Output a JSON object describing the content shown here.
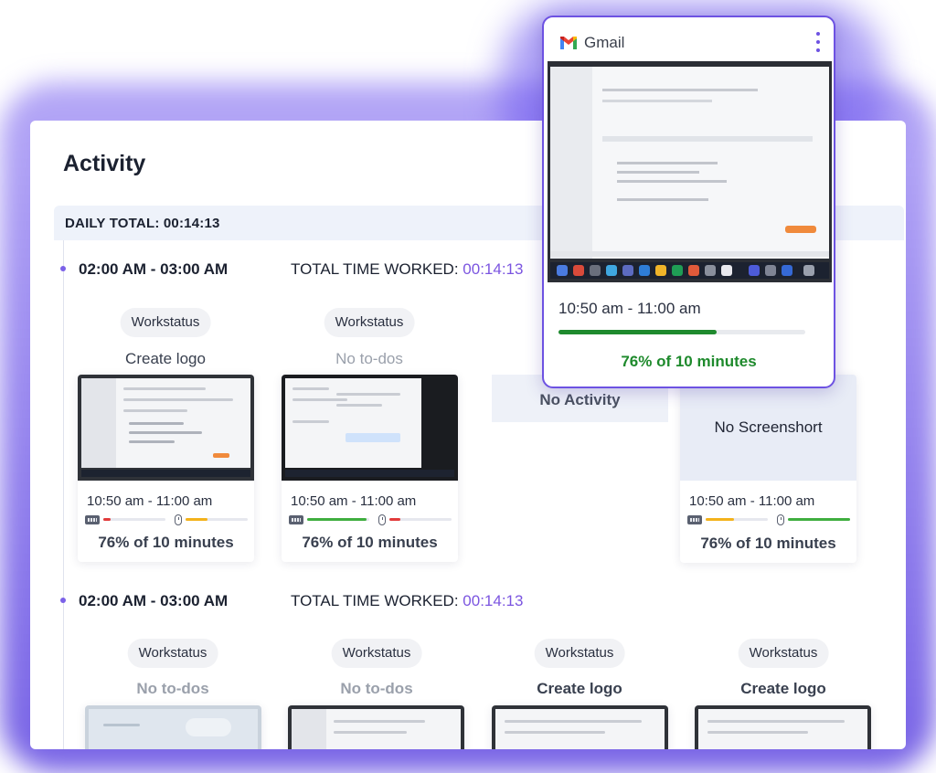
{
  "page": {
    "title": "Activity"
  },
  "daily_total": {
    "text": "DAILY TOTAL: 00:14:13"
  },
  "colors": {
    "accent": "#7b55e0",
    "green": "#3fae3f",
    "red": "#e23b3b",
    "yellow": "#f3b21b",
    "popup_green": "#1e8a2c"
  },
  "sections": [
    {
      "range": "02:00 AM - 03:00 AM",
      "total_label": "TOTAL TIME WORKED: ",
      "total_value": "00:14:13",
      "slots": [
        {
          "chip": "Workstatus",
          "todo": "Create logo",
          "time": "10:50 am - 11:00 am",
          "pct": "76% of 10 minutes",
          "keyboard_level": 0.12,
          "keyboard_color": "red",
          "mouse_level": 0.35,
          "mouse_color": "yellow"
        },
        {
          "chip": "Workstatus",
          "todo": "No to-dos",
          "time": "10:50 am - 11:00 am",
          "pct": "76% of 10 minutes",
          "keyboard_level": 0.95,
          "keyboard_color": "green",
          "mouse_level": 0.18,
          "mouse_color": "red"
        },
        {
          "label": "No Activity"
        },
        {
          "screenshot_placeholder": "No Screenshort",
          "time": "10:50 am - 11:00 am",
          "pct": "76% of 10 minutes",
          "keyboard_level": 0.45,
          "keyboard_color": "yellow",
          "mouse_level": 1.0,
          "mouse_color": "green"
        }
      ]
    },
    {
      "range": "02:00 AM - 03:00 AM",
      "total_label": "TOTAL TIME WORKED: ",
      "total_value": "00:14:13",
      "slots": [
        {
          "chip": "Workstatus",
          "todo": "No to-dos"
        },
        {
          "chip": "Workstatus",
          "todo": "No to-dos"
        },
        {
          "chip": "Workstatus",
          "todo": "Create logo"
        },
        {
          "chip": "Workstatus",
          "todo": "Create logo"
        }
      ]
    }
  ],
  "popup": {
    "app": "Gmail",
    "time": "10:50 am - 11:00 am",
    "progress": 0.64,
    "pct": "76% of 10 minutes"
  },
  "icons": [
    "gmail-icon",
    "more-vert-icon",
    "keyboard-icon",
    "mouse-icon"
  ]
}
